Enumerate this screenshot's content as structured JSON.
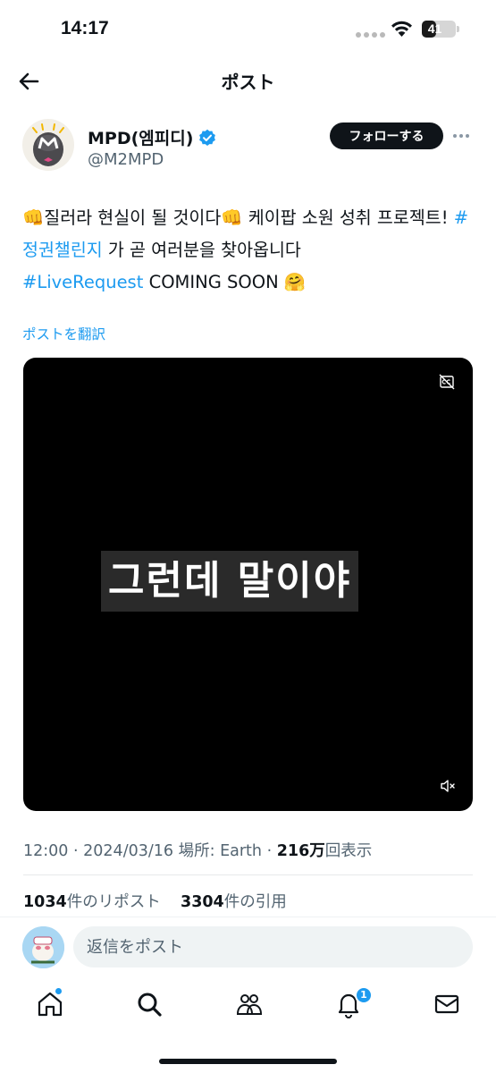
{
  "status_bar": {
    "time": "14:17",
    "battery": "41",
    "battery_level": 0.41
  },
  "header": {
    "title": "ポスト",
    "back_icon": "arrow-left-icon"
  },
  "author": {
    "name": "MPD(엠피디)",
    "handle": "@M2MPD",
    "verified_icon": "verified-badge-icon",
    "follow_label": "フォローする",
    "more_icon": "more-horizontal-icon"
  },
  "post": {
    "emoji_fist": "👊",
    "text_part1": "질러라 현실이 될 것이다",
    "text_part2": " 케이팝 소원 성취 프로젝트! ",
    "hashtag1": "#정권챌린지",
    "text_part3": " 가 곧 여러분을 찾아옵니다",
    "hashtag2": "#LiveRequest",
    "text_part4": " COMING SOON ",
    "emoji_hug": "🤗",
    "translate_label": "ポストを翻訳"
  },
  "video": {
    "subtitle": "그런데 말이야",
    "cc_icon": "captions-off-icon",
    "mute_icon": "volume-muted-icon"
  },
  "meta": {
    "time": "12:00",
    "date": "2024/03/16",
    "location_label": "場所: Earth",
    "views_count": "216万",
    "views_label": "回表示"
  },
  "stats": {
    "reposts_count": "1034",
    "reposts_label": "件のリポスト",
    "quotes_count": "3304",
    "quotes_label": "件の引用"
  },
  "reply": {
    "placeholder": "返信をポスト"
  },
  "tabbar": {
    "items": [
      "home-icon",
      "search-icon",
      "communities-icon",
      "notifications-icon",
      "messages-icon"
    ],
    "notification_badge": "1",
    "accent": "#1d9bf0"
  }
}
